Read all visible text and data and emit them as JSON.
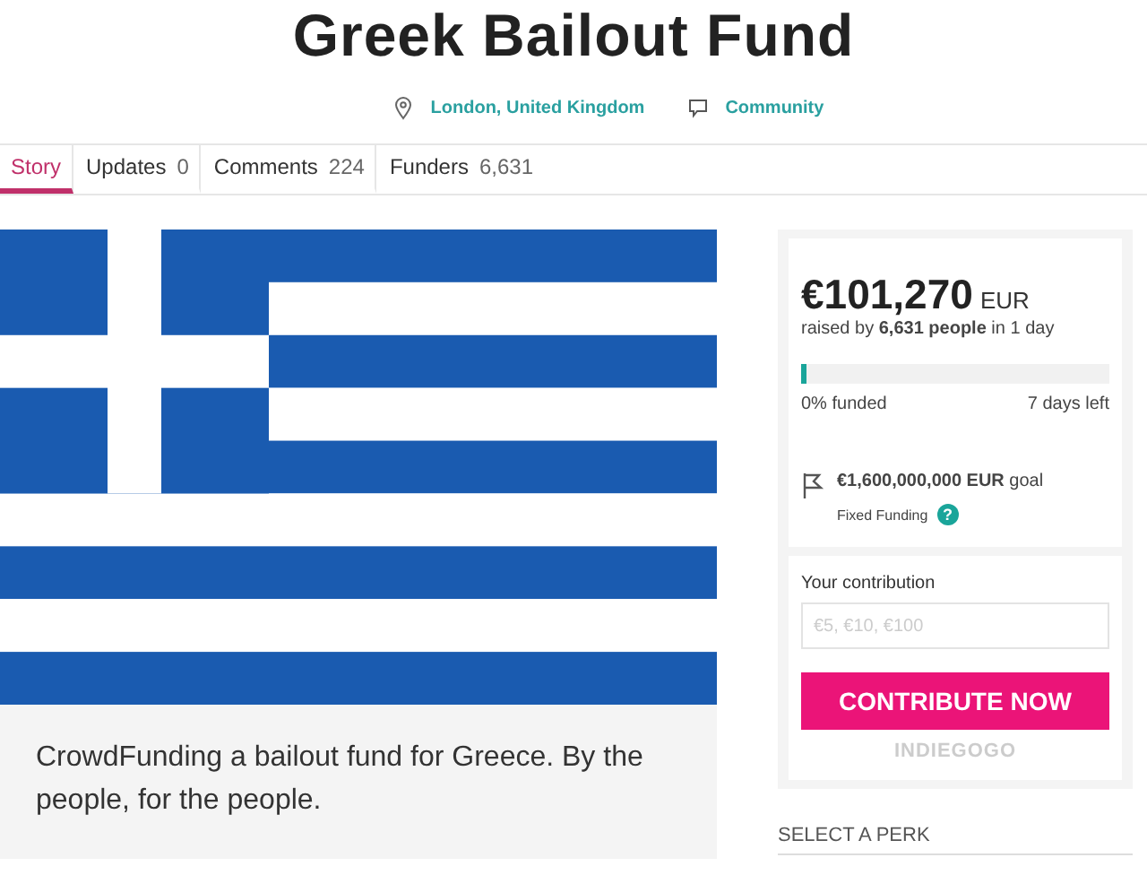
{
  "title": "Greek Bailout Fund",
  "meta": [
    {
      "kind": "location",
      "label": "London, United Kingdom"
    },
    {
      "kind": "category",
      "label": "Community"
    }
  ],
  "tabs": [
    {
      "label": "Story",
      "selected": true
    },
    {
      "label": "Updates",
      "count": "0",
      "selected": false
    },
    {
      "label": "Comments",
      "count": "224",
      "selected": false
    },
    {
      "label": "Funders",
      "count": "6,631",
      "selected": false
    }
  ],
  "caption": "CrowdFunding a bailout fund for Greece. By the people, for the people.",
  "campaign": {
    "amount": "€101,270",
    "currency": "EUR",
    "raised": "raised by **6,631 people** in 1 day",
    "level": 0.01,
    "funded": "0% funded",
    "days_left": "7 days left",
    "goal": "**€1,600,000,000 EUR** goal",
    "funding_type": "Fixed Funding",
    "help": "?"
  },
  "contribution": {
    "label": "Your contribution",
    "placeholder": "€5, €10, €100",
    "button": "CONTRIBUTE NOW",
    "brand": "INDIEGOGO"
  },
  "perk_heading": "SELECT A PERK"
}
